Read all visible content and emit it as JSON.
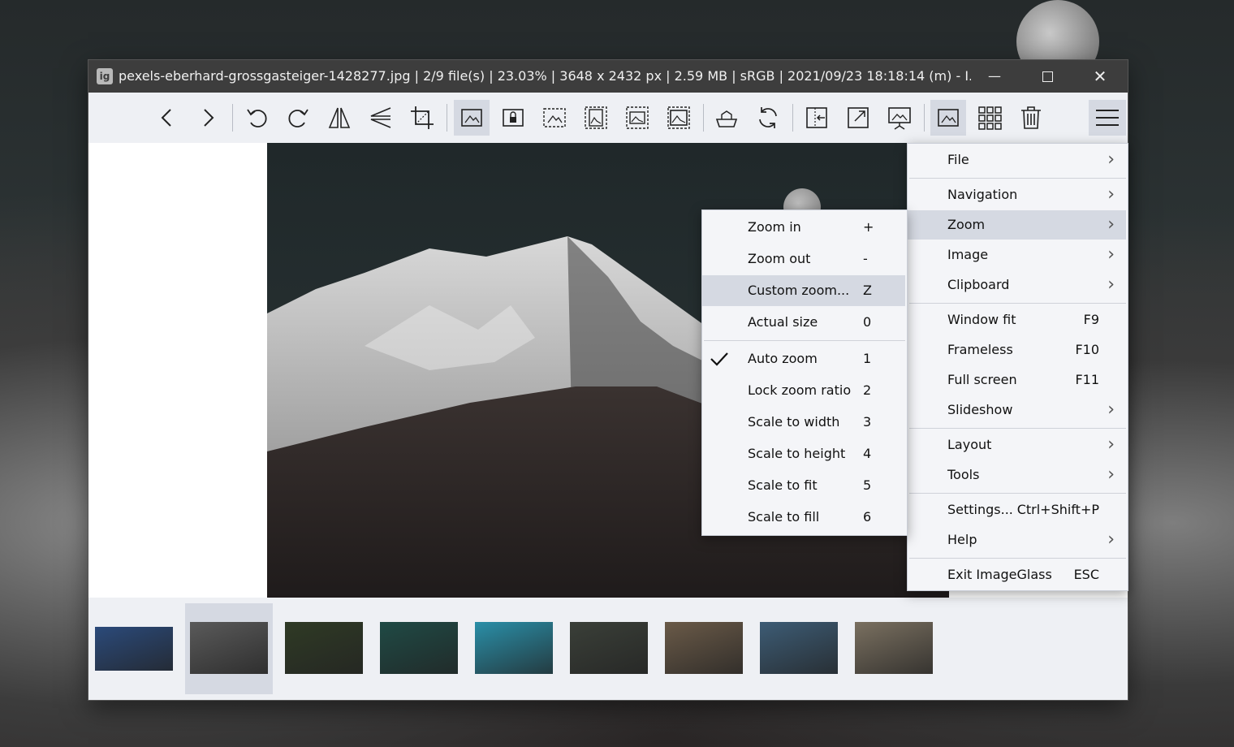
{
  "window": {
    "title": "pexels-eberhard-grossgasteiger-1428277.jpg  |  2/9 file(s)  |  23.03%  |  3648 x 2432 px  |  2.59 MB  |  sRGB  |  2021/09/23 18:18:14 (m)  - I...",
    "app_icon_text": "ig"
  },
  "toolbar": {
    "icons": [
      "arrow-left-icon",
      "arrow-right-icon",
      "rotate-left-icon",
      "rotate-right-icon",
      "flip-horizontal-icon",
      "flip-vertical-icon",
      "crop-icon",
      "auto-zoom-icon",
      "lock-zoom-icon",
      "scale-width-icon",
      "scale-height-icon",
      "scale-fit-icon",
      "scale-fill-icon",
      "open-with-icon",
      "refresh-icon",
      "window-fit-icon",
      "fullscreen-icon",
      "slideshow-icon",
      "thumbnail-bar-icon",
      "grid-icon",
      "delete-icon",
      "menu-icon"
    ]
  },
  "main_menu": {
    "items": [
      {
        "label": "File",
        "shortcut": "",
        "submenu": true
      },
      {
        "label": "Navigation",
        "shortcut": "",
        "submenu": true
      },
      {
        "label": "Zoom",
        "shortcut": "",
        "submenu": true
      },
      {
        "label": "Image",
        "shortcut": "",
        "submenu": true
      },
      {
        "label": "Clipboard",
        "shortcut": "",
        "submenu": true
      },
      {
        "label": "Window fit",
        "shortcut": "F9",
        "submenu": false
      },
      {
        "label": "Frameless",
        "shortcut": "F10",
        "submenu": false
      },
      {
        "label": "Full screen",
        "shortcut": "F11",
        "submenu": false
      },
      {
        "label": "Slideshow",
        "shortcut": "",
        "submenu": true
      },
      {
        "label": "Layout",
        "shortcut": "",
        "submenu": true
      },
      {
        "label": "Tools",
        "shortcut": "",
        "submenu": true
      },
      {
        "label": "Settings...",
        "shortcut": "Ctrl+Shift+P",
        "submenu": false
      },
      {
        "label": "Help",
        "shortcut": "",
        "submenu": true
      },
      {
        "label": "Exit ImageGlass",
        "shortcut": "ESC",
        "submenu": false
      }
    ]
  },
  "zoom_menu": {
    "items": [
      {
        "label": "Zoom in",
        "shortcut": "+"
      },
      {
        "label": "Zoom out",
        "shortcut": "-"
      },
      {
        "label": "Custom zoom...",
        "shortcut": "Z"
      },
      {
        "label": "Actual size",
        "shortcut": "0"
      },
      {
        "label": "Auto zoom",
        "shortcut": "1",
        "checked": true
      },
      {
        "label": "Lock zoom ratio",
        "shortcut": "2"
      },
      {
        "label": "Scale to width",
        "shortcut": "3"
      },
      {
        "label": "Scale to height",
        "shortcut": "4"
      },
      {
        "label": "Scale to fit",
        "shortcut": "5"
      },
      {
        "label": "Scale to fill",
        "shortcut": "6"
      }
    ]
  },
  "thumbnails": {
    "count": 9,
    "selected_index": 1,
    "colors": [
      "#2b4a7a",
      "#5a5a5a",
      "#2f3a25",
      "#1f4a45",
      "#2a8fa8",
      "#3a3f38",
      "#6a5a48",
      "#3d5c75",
      "#7a7060"
    ]
  }
}
